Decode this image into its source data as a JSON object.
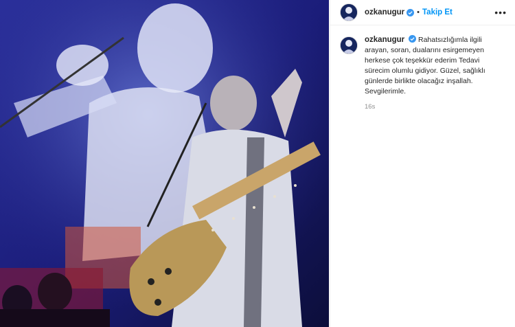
{
  "post": {
    "username": "ozkanugur",
    "follow_label": "Takip Et",
    "separator": "•",
    "more_label": "•••",
    "caption": "Rahatsızlığımla ilgili arayan, soran, dualarını esirgemeyen herkese çok teşekkür ederim Tedavi sürecim olumlu gidiyor. Güzel, sağlıklı günlerde birlikte olacağız inşallah. Sevgilerimle.",
    "time": "16s"
  },
  "colors": {
    "follow": "#0095f6",
    "verified": "#3897f0",
    "muted": "#8e8e8e"
  },
  "icons": {
    "verified": "verified-badge-icon",
    "more": "more-options-icon"
  }
}
